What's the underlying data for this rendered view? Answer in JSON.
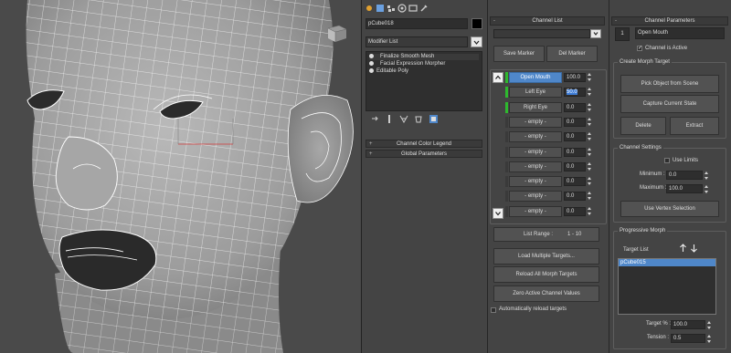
{
  "viewport": {
    "name": "Perspective viewport"
  },
  "modify_panel": {
    "object_name": "pCube018",
    "object_color": "#000000",
    "modifier_list_label": "Modifier List",
    "stack": [
      {
        "label": "Finalize Smooth Mesh",
        "selected": true
      },
      {
        "label": "Facial Expression Morpher",
        "selected": false
      },
      {
        "label": "Editable Poly",
        "selected": false
      }
    ],
    "rollouts": {
      "channel_color_legend": "Channel Color Legend",
      "global_parameters": "Global Parameters"
    }
  },
  "channel_list": {
    "title": "Channel List",
    "dropdown_value": "",
    "save_marker": "Save Marker",
    "del_marker": "Del Marker",
    "channels": [
      {
        "name": "Open Mouth",
        "value": "100.0",
        "active": true,
        "indicator": "#2eb82e",
        "value_highlight": false
      },
      {
        "name": "Left Eye",
        "value": "50.0",
        "active": false,
        "indicator": "#2eb82e",
        "value_highlight": true
      },
      {
        "name": "Right Eye",
        "value": "0.0",
        "active": false,
        "indicator": "#2eb82e",
        "value_highlight": false
      },
      {
        "name": "- empty -",
        "value": "0.0",
        "active": false,
        "indicator": "#3a3a3a",
        "value_highlight": false
      },
      {
        "name": "- empty -",
        "value": "0.0",
        "active": false,
        "indicator": "#3a3a3a",
        "value_highlight": false
      },
      {
        "name": "- empty -",
        "value": "0.0",
        "active": false,
        "indicator": "#3a3a3a",
        "value_highlight": false
      },
      {
        "name": "- empty -",
        "value": "0.0",
        "active": false,
        "indicator": "#3a3a3a",
        "value_highlight": false
      },
      {
        "name": "- empty -",
        "value": "0.0",
        "active": false,
        "indicator": "#3a3a3a",
        "value_highlight": false
      },
      {
        "name": "- empty -",
        "value": "0.0",
        "active": false,
        "indicator": "#3a3a3a",
        "value_highlight": false
      },
      {
        "name": "- empty -",
        "value": "0.0",
        "active": false,
        "indicator": "#3a3a3a",
        "value_highlight": false
      }
    ],
    "list_range_label": "List Range :",
    "list_range_value": "1 - 10",
    "load_multiple": "Load Multiple Targets...",
    "reload_all": "Reload All Morph Targets",
    "zero_active": "Zero Active Channel Values",
    "auto_reload": "Automatically reload targets"
  },
  "channel_parameters": {
    "title": "Channel Parameters",
    "channel_number": "1",
    "channel_name": "Open Mouth",
    "channel_active_label": "Channel is Active",
    "create_morph_target": "Create Morph Target",
    "pick_object": "Pick Object from Scene",
    "capture_state": "Capture Current State",
    "delete": "Delete",
    "extract": "Extract",
    "channel_settings": "Channel Settings",
    "use_limits": "Use Limits",
    "minimum_label": "Minimum :",
    "minimum_value": "0.0",
    "maximum_label": "Maximum :",
    "maximum_value": "100.0",
    "use_vertex_selection": "Use Vertex Selection",
    "progressive_morph": "Progressive Morph",
    "target_list_label": "Target List",
    "targets": [
      "pCube015"
    ],
    "target_pct_label": "Target % :",
    "target_pct_value": "100.0",
    "tension_label": "Tension :",
    "tension_value": "0.5"
  },
  "colors": {
    "accent": "#4f87c9",
    "active_channel": "#2eb82e",
    "panel_bg": "#444444",
    "viewport_bg": "#4a4a4a"
  }
}
